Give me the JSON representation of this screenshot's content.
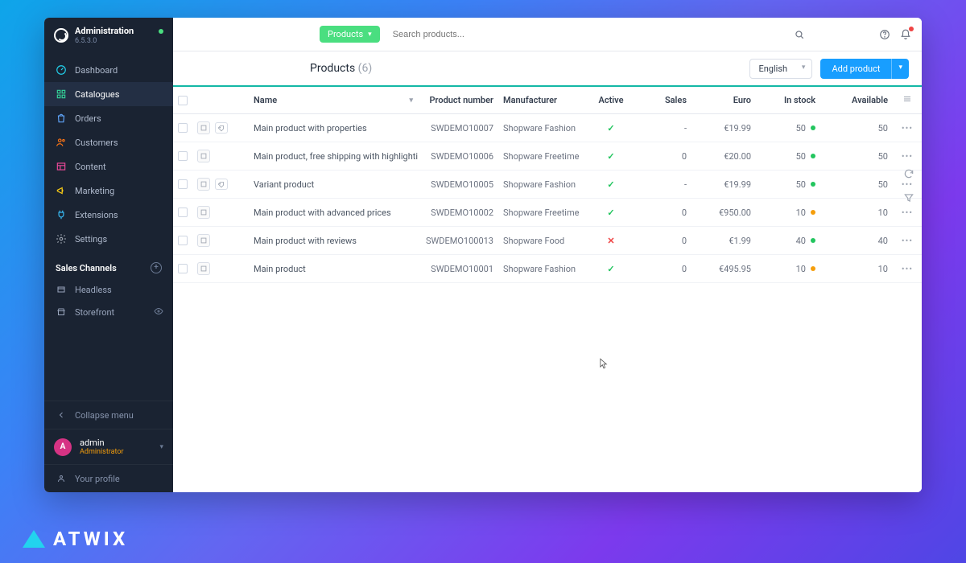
{
  "brand": {
    "title": "Administration",
    "version": "6.5.3.0"
  },
  "sidebar": {
    "items": [
      {
        "label": "Dashboard"
      },
      {
        "label": "Catalogues"
      },
      {
        "label": "Orders"
      },
      {
        "label": "Customers"
      },
      {
        "label": "Content"
      },
      {
        "label": "Marketing"
      },
      {
        "label": "Extensions"
      },
      {
        "label": "Settings"
      }
    ],
    "section_label": "Sales Channels",
    "channels": [
      {
        "label": "Headless"
      },
      {
        "label": "Storefront"
      }
    ],
    "collapse_label": "Collapse menu",
    "user": {
      "initial": "A",
      "name": "admin",
      "role": "Administrator"
    },
    "profile_label": "Your profile"
  },
  "topbar": {
    "context_label": "Products",
    "search_placeholder": "Search products..."
  },
  "listbar": {
    "title": "Products",
    "count": "(6)",
    "language": "English",
    "add_label": "Add product"
  },
  "table": {
    "headers": {
      "name": "Name",
      "product_number": "Product number",
      "manufacturer": "Manufacturer",
      "active": "Active",
      "sales": "Sales",
      "euro": "Euro",
      "in_stock": "In stock",
      "available": "Available"
    },
    "rows": [
      {
        "name": "Main product with properties",
        "number": "SWDEMO10007",
        "manufacturer": "Shopware Fashion",
        "active": true,
        "sales": "-",
        "price": "€19.99",
        "stock": "50",
        "stock_state": "green",
        "available": "50",
        "variant": true
      },
      {
        "name": "Main product, free shipping with highlighting",
        "number": "SWDEMO10006",
        "manufacturer": "Shopware Freetime",
        "active": true,
        "sales": "0",
        "price": "€20.00",
        "stock": "50",
        "stock_state": "green",
        "available": "50",
        "variant": false
      },
      {
        "name": "Variant product",
        "number": "SWDEMO10005",
        "manufacturer": "Shopware Fashion",
        "active": true,
        "sales": "-",
        "price": "€19.99",
        "stock": "50",
        "stock_state": "green",
        "available": "50",
        "variant": true
      },
      {
        "name": "Main product with advanced prices",
        "number": "SWDEMO10002",
        "manufacturer": "Shopware Freetime",
        "active": true,
        "sales": "0",
        "price": "€950.00",
        "stock": "10",
        "stock_state": "amber",
        "available": "10",
        "variant": false
      },
      {
        "name": "Main product with reviews",
        "number": "SWDEMO100013",
        "manufacturer": "Shopware Food",
        "active": false,
        "sales": "0",
        "price": "€1.99",
        "stock": "40",
        "stock_state": "green",
        "available": "40",
        "variant": false
      },
      {
        "name": "Main product",
        "number": "SWDEMO10001",
        "manufacturer": "Shopware Fashion",
        "active": true,
        "sales": "0",
        "price": "€495.95",
        "stock": "10",
        "stock_state": "amber",
        "available": "10",
        "variant": false
      }
    ]
  },
  "overlay_brand": "ATWIX"
}
